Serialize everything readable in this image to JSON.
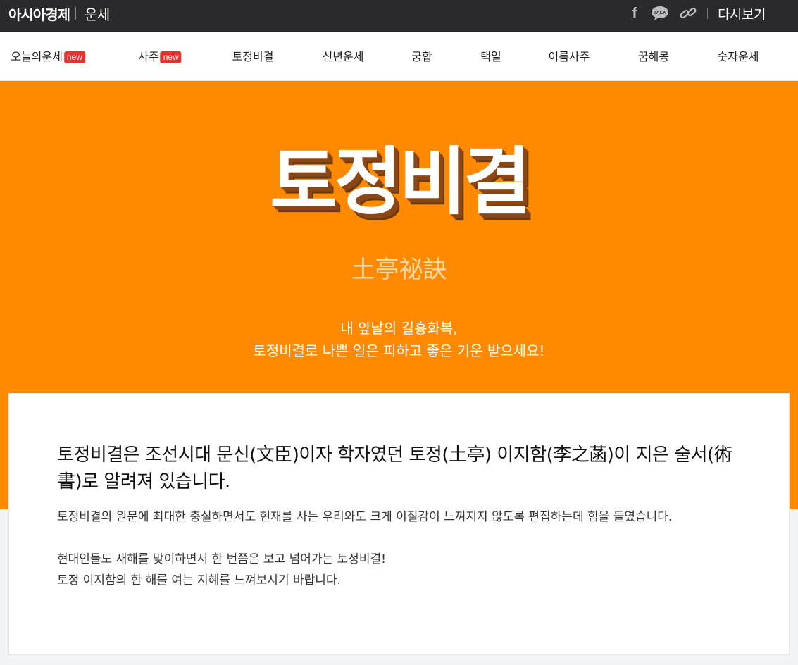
{
  "header": {
    "brand": "아시아경제",
    "section": "운세",
    "icons": [
      "facebook-icon",
      "kakaotalk-icon",
      "link-icon"
    ],
    "talk_label": "TALK",
    "replay_label": "다시보기"
  },
  "nav": {
    "items": [
      {
        "label": "오늘의운세",
        "badge": "new"
      },
      {
        "label": "사주",
        "badge": "new"
      },
      {
        "label": "토정비결"
      },
      {
        "label": "신년운세"
      },
      {
        "label": "궁합"
      },
      {
        "label": "택일"
      },
      {
        "label": "이름사주"
      },
      {
        "label": "꿈해몽"
      },
      {
        "label": "숫자운세"
      }
    ]
  },
  "hero": {
    "title": "토정비결",
    "hanja": "土亭祕訣",
    "subtitle_line1": "내 앞날의 길흉화복,",
    "subtitle_line2": "토정비결로 나쁜 일은 피하고 좋은 기운 받으세요!"
  },
  "intro": {
    "heading": "토정비결은 조선시대 문신(文臣)이자 학자였던 토정(土亭) 이지함(李之菡)이 지은 술서(術書)로 알려져 있습니다.",
    "paragraph1": "토정비결의 원문에 최대한 충실하면서도 현재를 사는 우리와도 크게 이질감이 느껴지지 않도록 편집하는데 힘을 들였습니다.",
    "paragraph2_line1": "현대인들도 새해를 맞이하면서 한 번쯤은 보고 넘어가는 토정비결!",
    "paragraph2_line2": "토정 이지함의 한 해를 여는 지혜를 느껴보시기 바랍니다."
  },
  "colors": {
    "topbar": "#2a2a2c",
    "hero_bg": "#ff8a00",
    "badge": "#e8312f",
    "title_shadow": "#8a4614"
  }
}
